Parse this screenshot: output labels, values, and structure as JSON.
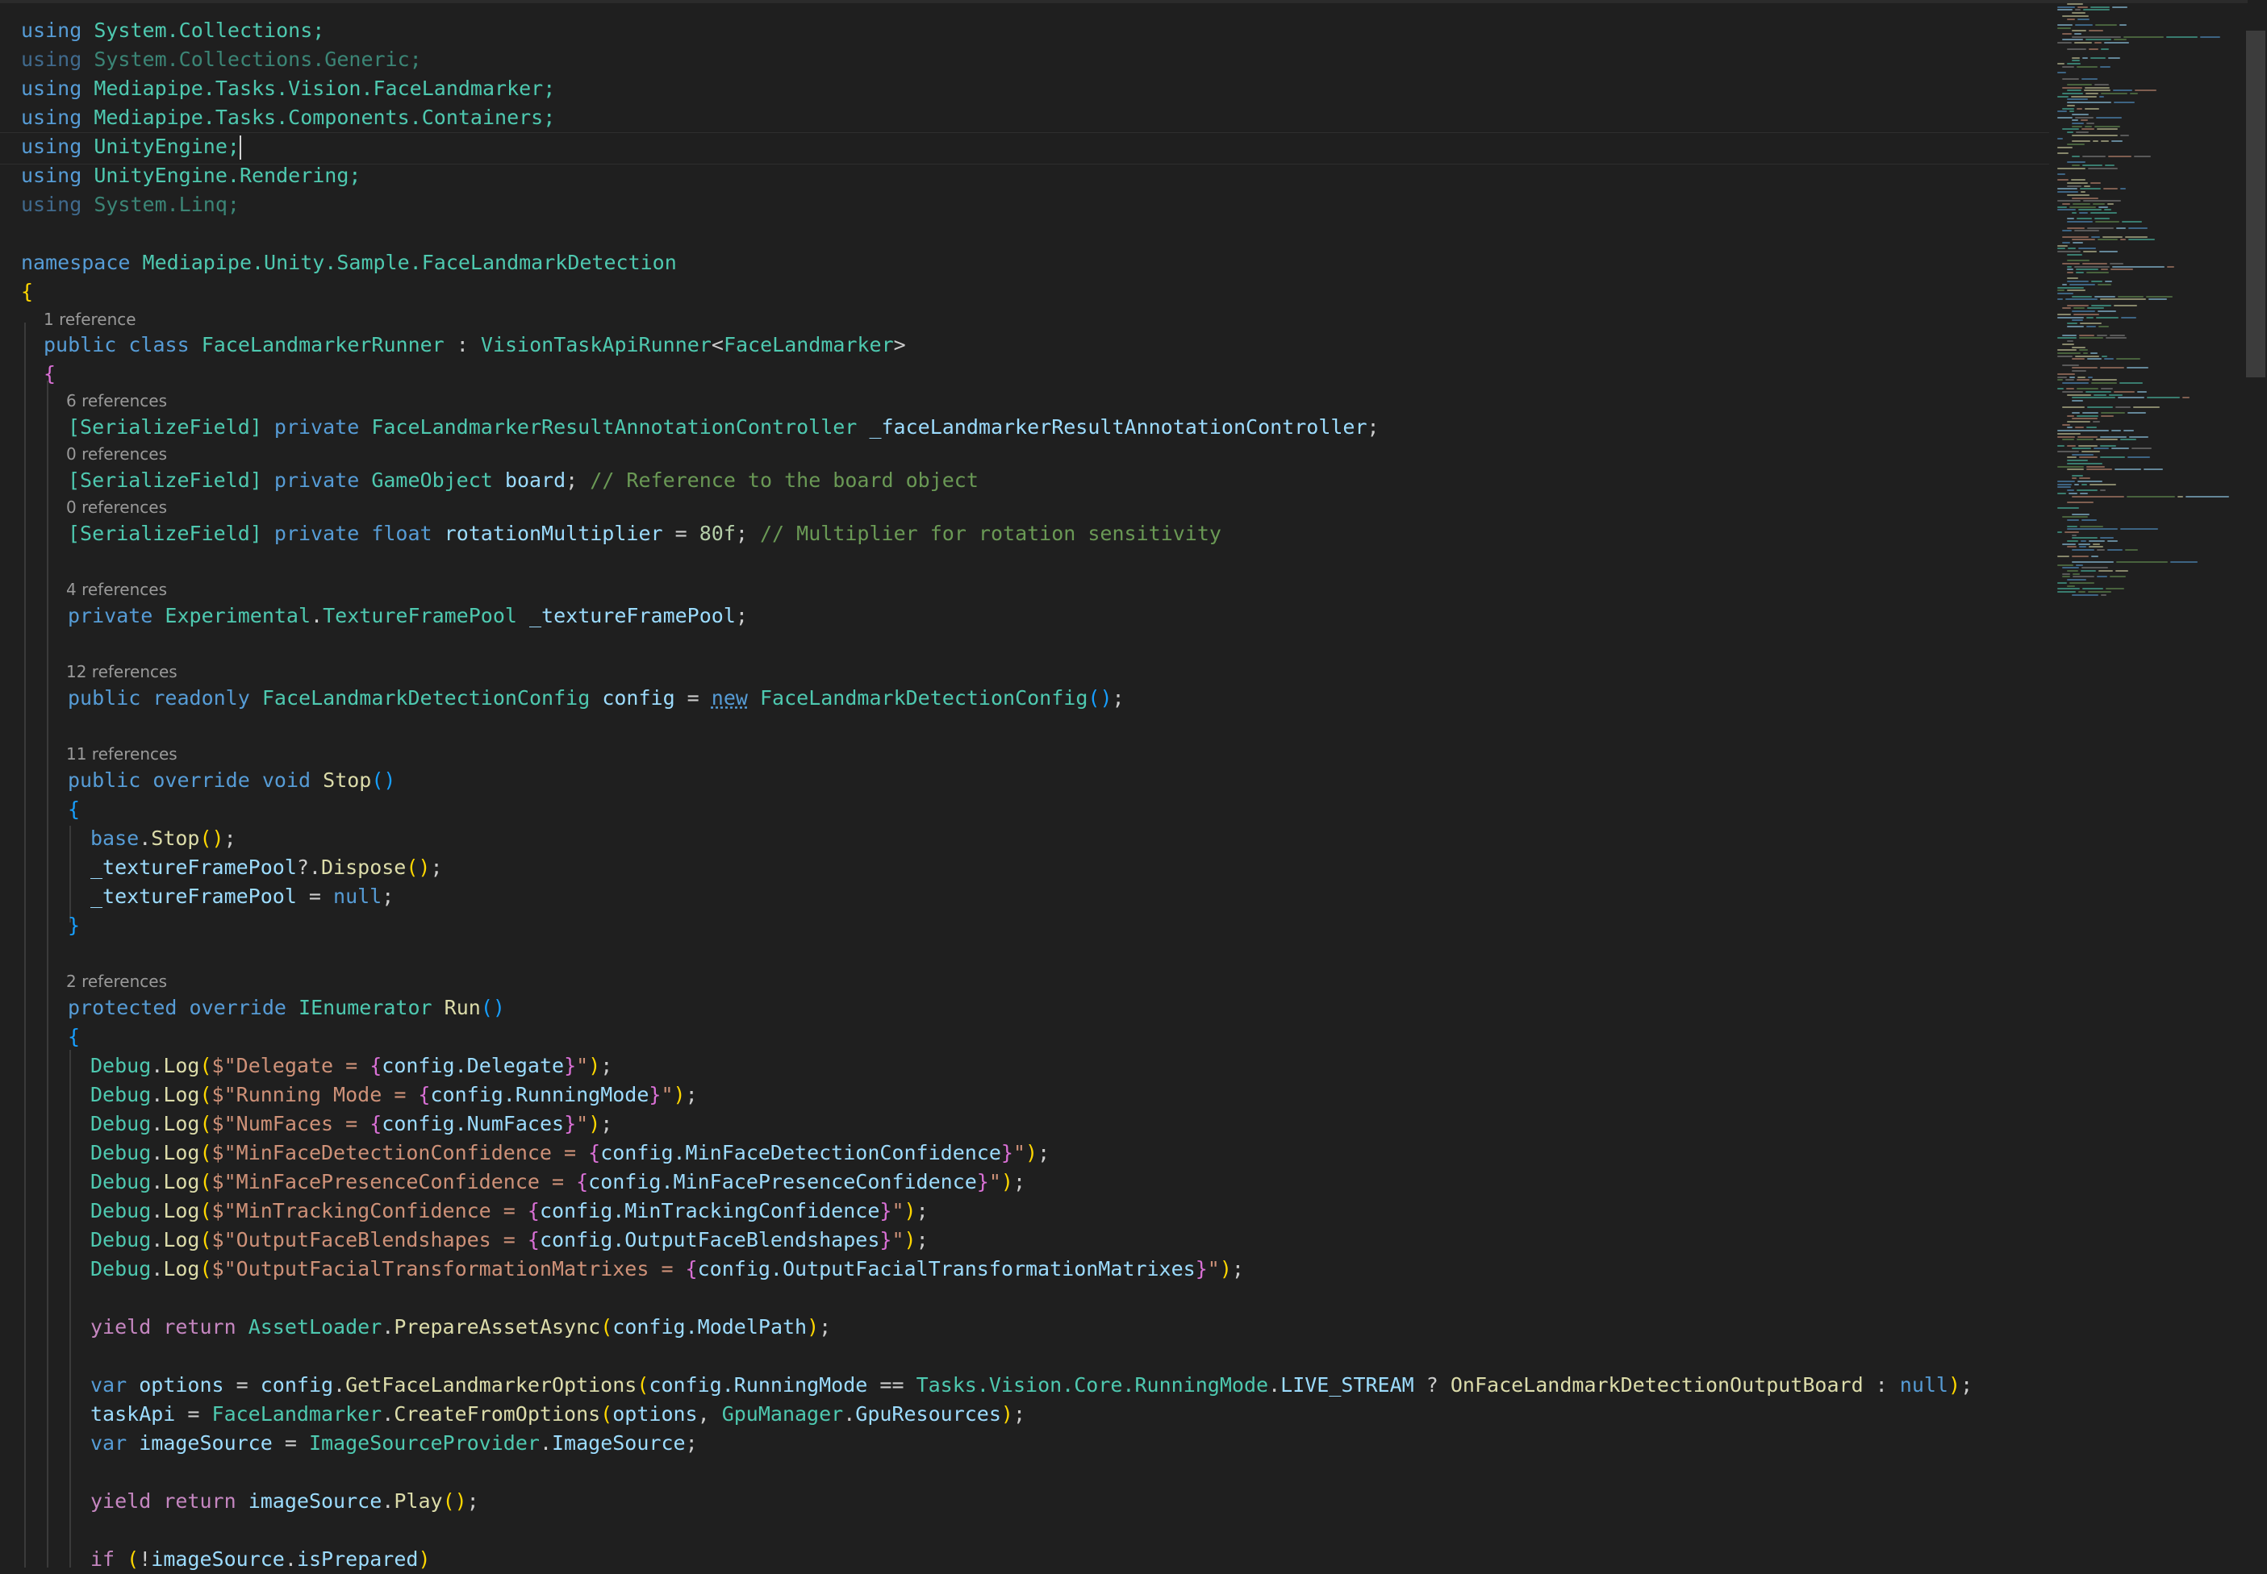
{
  "colors": {
    "background": "#1f1f1f",
    "keyword": "#569cd6",
    "type": "#4ec9b0",
    "identifier": "#9cdcfe",
    "function": "#dcdcaa",
    "string": "#ce9178",
    "number": "#b5cea8",
    "comment": "#6a9955",
    "codelens": "#9a9a9a"
  },
  "code": {
    "using_kw": "using",
    "system_collections": "System.Collections;",
    "system_collections_generic": "System.Collections.Generic;",
    "mediapipe_facelandmarker": "Mediapipe.Tasks.Vision.FaceLandmarker;",
    "mediapipe_containers": "Mediapipe.Tasks.Components.Containers;",
    "unityengine": "UnityEngine;",
    "unityengine_rendering": "UnityEngine.Rendering;",
    "system_linq": "System.Linq;",
    "namespace_kw": "namespace",
    "namespace_name": "Mediapipe.Unity.Sample.FaceLandmarkDetection",
    "lens_1": "1 reference",
    "lens_2": "6 references",
    "lens_3": "0 references",
    "lens_4": "0 references",
    "lens_5": "4 references",
    "lens_6": "12 references",
    "lens_7": "11 references",
    "lens_8": "2 references",
    "class_public": "public",
    "class_kw": "class",
    "class_name": "FaceLandmarkerRunner",
    "class_base": "VisionTaskApiRunner",
    "class_generic": "FaceLandmarker",
    "serialize_field": "[SerializeField]",
    "private_kw": "private",
    "annotation_type": "FaceLandmarkerResultAnnotationController",
    "annotation_field": "_faceLandmarkerResultAnnotationController",
    "gameobject_type": "GameObject",
    "board_field": "board",
    "board_comment": "// Reference to the board object",
    "float_kw": "float",
    "rotation_field": "rotationMultiplier",
    "rotation_value": "80f",
    "rotation_comment": "// Multiplier for rotation sensitivity",
    "experimental_ns": "Experimental",
    "texture_pool_type": "TextureFramePool",
    "texture_pool_field": "_textureFramePool",
    "public_kw": "public",
    "readonly_kw": "readonly",
    "config_type": "FaceLandmarkDetectionConfig",
    "config_field": "config",
    "new_kw": "new",
    "override_kw": "override",
    "void_kw": "void",
    "stop_method": "Stop",
    "base_kw": "base",
    "dispose_method": "Dispose",
    "null_kw": "null",
    "protected_kw": "protected",
    "ienumerator_type": "IEnumerator",
    "run_method": "Run",
    "debug_type": "Debug",
    "log_method": "Log",
    "log_delegate_str": "$\"Delegate = ",
    "log_delegate_arg": "config.Delegate",
    "log_runningmode_str": "$\"Running Mode = ",
    "log_runningmode_arg": "config.RunningMode",
    "log_numfaces_str": "$\"NumFaces = ",
    "log_numfaces_arg": "config.NumFaces",
    "log_mindetect_str": "$\"MinFaceDetectionConfidence = ",
    "log_mindetect_arg": "config.MinFaceDetectionConfidence",
    "log_minpresence_str": "$\"MinFacePresenceConfidence = ",
    "log_minpresence_arg": "config.MinFacePresenceConfidence",
    "log_mintracking_str": "$\"MinTrackingConfidence = ",
    "log_mintracking_arg": "config.MinTrackingConfidence",
    "log_blendshapes_str": "$\"OutputFaceBlendshapes = ",
    "log_blendshapes_arg": "config.OutputFaceBlendshapes",
    "log_matrixes_str": "$\"OutputFacialTransformationMatrixes = ",
    "log_matrixes_arg": "config.OutputFacialTransformationMatrixes",
    "yield_kw": "yield",
    "return_kw": "return",
    "assetloader_type": "AssetLoader",
    "prepare_method": "PrepareAssetAsync",
    "modelpath_arg": "config.ModelPath",
    "var_kw": "var",
    "options_var": "options",
    "get_options_method": "GetFaceLandmarkerOptions",
    "running_mode_arg": "config.RunningMode",
    "tasks_vision_core": "Tasks.Vision.Core.",
    "running_mode_type": "RunningMode",
    "live_stream": "LIVE_STREAM",
    "callback_method": "OnFaceLandmarkDetectionOutputBoard",
    "taskapi_var": "taskApi",
    "facelandmarker_type": "FaceLandmarker",
    "create_method": "CreateFromOptions",
    "gpumanager_type": "GpuManager",
    "gpuresources": "GpuResources",
    "imagesource_var": "imageSource",
    "provider_type": "ImageSourceProvider",
    "imagesource_prop": "ImageSource",
    "play_method": "Play",
    "if_kw": "if",
    "is_prepared": "isPrepared"
  }
}
